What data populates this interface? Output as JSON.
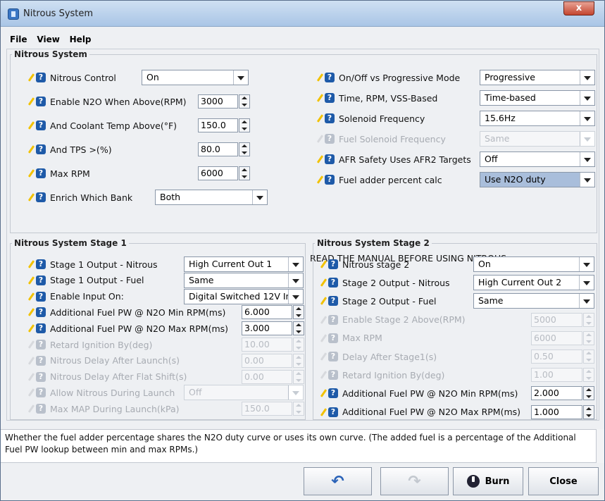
{
  "window": {
    "title": "Nitrous System",
    "close_label": "x"
  },
  "menu": [
    "File",
    "View",
    "Help"
  ],
  "main_group": {
    "legend": "Nitrous System",
    "left_rows": [
      {
        "label": "Nitrous Control",
        "type": "combo",
        "value": "On"
      },
      {
        "label": "Enable N2O When Above(RPM)",
        "type": "spin",
        "value": "3000"
      },
      {
        "label": "And Coolant Temp Above(°F)",
        "type": "spin",
        "value": "150.0"
      },
      {
        "label": "And TPS >(%)",
        "type": "spin",
        "value": "80.0"
      },
      {
        "label": "Max RPM",
        "type": "spin",
        "value": "6000"
      },
      {
        "label": "Enrich Which Bank",
        "type": "combo",
        "value": "Both"
      }
    ],
    "right_rows": [
      {
        "label": "On/Off vs Progressive Mode",
        "value": "Progressive",
        "disabled": false
      },
      {
        "label": "Time, RPM, VSS-Based",
        "value": "Time-based",
        "disabled": false
      },
      {
        "label": "Solenoid Frequency",
        "value": "15.6Hz",
        "disabled": false
      },
      {
        "label": "Fuel Solenoid Frequency",
        "value": "Same",
        "disabled": true
      },
      {
        "label": "AFR Safety Uses AFR2 Targets",
        "value": "Off",
        "disabled": false
      },
      {
        "label": "Fuel adder percent calc",
        "value": "Use N2O duty",
        "disabled": false,
        "selected": true
      }
    ],
    "notice": "READ THE MANUAL BEFORE USING NITROUS"
  },
  "stage1": {
    "legend": "Nitrous System Stage 1",
    "rows": [
      {
        "label": "Stage 1 Output - Nitrous",
        "type": "combo",
        "value": "High Current Out 1",
        "disabled": false
      },
      {
        "label": "Stage 1 Output - Fuel",
        "type": "combo",
        "value": "Same",
        "disabled": false
      },
      {
        "label": "Enable Input On:",
        "type": "combo",
        "value": "Digital Switched 12V In",
        "disabled": false
      },
      {
        "label": "Additional Fuel PW @ N2O Min RPM(ms)",
        "type": "spin",
        "value": "6.000",
        "disabled": false
      },
      {
        "label": "Additional Fuel PW @ N2O Max RPM(ms)",
        "type": "spin",
        "value": "3.000",
        "disabled": false
      },
      {
        "label": "Retard Ignition By(deg)",
        "type": "spin",
        "value": "10.00",
        "disabled": true
      },
      {
        "label": "Nitrous Delay After Launch(s)",
        "type": "spin",
        "value": "0.00",
        "disabled": true
      },
      {
        "label": "Nitrous Delay After Flat Shift(s)",
        "type": "spin",
        "value": "0.00",
        "disabled": true
      },
      {
        "label": "Allow Nitrous During Launch",
        "type": "combo",
        "value": "Off",
        "disabled": true
      },
      {
        "label": "Max MAP During Launch(kPa)",
        "type": "spin",
        "value": "150.0",
        "disabled": true
      }
    ]
  },
  "stage2": {
    "legend": "Nitrous System Stage 2",
    "rows": [
      {
        "label": "Nitrous stage 2",
        "type": "combo",
        "value": "On",
        "disabled": false
      },
      {
        "label": "Stage 2 Output - Nitrous",
        "type": "combo",
        "value": "High Current Out 2",
        "disabled": false
      },
      {
        "label": "Stage 2 Output - Fuel",
        "type": "combo",
        "value": "Same",
        "disabled": false
      },
      {
        "label": "Enable Stage 2 Above(RPM)",
        "type": "spin",
        "value": "5000",
        "disabled": true
      },
      {
        "label": "Max RPM",
        "type": "spin",
        "value": "6000",
        "disabled": true
      },
      {
        "label": "Delay After Stage1(s)",
        "type": "spin",
        "value": "0.50",
        "disabled": true
      },
      {
        "label": "Retard Ignition By(deg)",
        "type": "spin",
        "value": "1.00",
        "disabled": true
      },
      {
        "label": "Additional Fuel PW @ N2O Min RPM(ms)",
        "type": "spin",
        "value": "2.000",
        "disabled": false
      },
      {
        "label": "Additional Fuel PW @ N2O Max RPM(ms)",
        "type": "spin",
        "value": "1.000",
        "disabled": false
      }
    ]
  },
  "description": "Whether the fuel adder percentage shares the N2O duty curve or uses its own curve. (The added fuel is a percentage of the Additional Fuel PW lookup between min and max RPMs.)",
  "buttons": {
    "undo_icon": "undo-arrow-icon",
    "redo_icon": "redo-arrow-icon",
    "burn": "Burn",
    "close": "Close"
  }
}
